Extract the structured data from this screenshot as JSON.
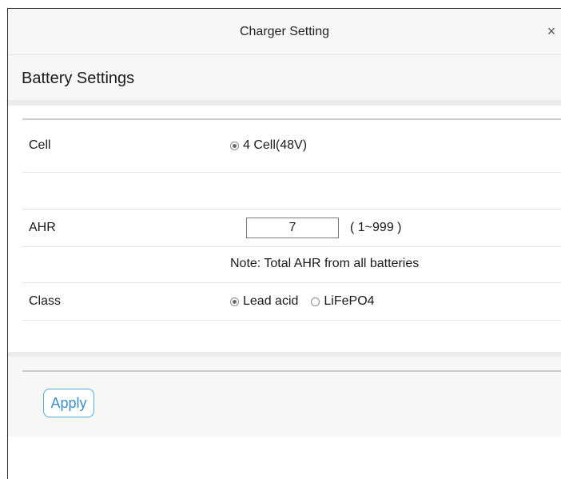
{
  "dialog": {
    "title": "Charger Setting",
    "close_glyph": "×"
  },
  "section": {
    "title": "Battery Settings"
  },
  "rows": {
    "cell": {
      "label": "Cell",
      "option": "4 Cell(48V)",
      "selected": true
    },
    "ahr": {
      "label": "AHR",
      "value": "7",
      "range": "( 1~999 )"
    },
    "note": {
      "text": "Note: Total AHR from all batteries"
    },
    "class": {
      "label": "Class",
      "options": [
        {
          "label": "Lead acid",
          "selected": true
        },
        {
          "label": "LiFePO4",
          "selected": false
        }
      ]
    }
  },
  "footer": {
    "apply_label": "Apply"
  },
  "colors": {
    "accent": "#3d8ec4",
    "panel_bg": "#f7f7f7",
    "separator": "#ececec"
  }
}
